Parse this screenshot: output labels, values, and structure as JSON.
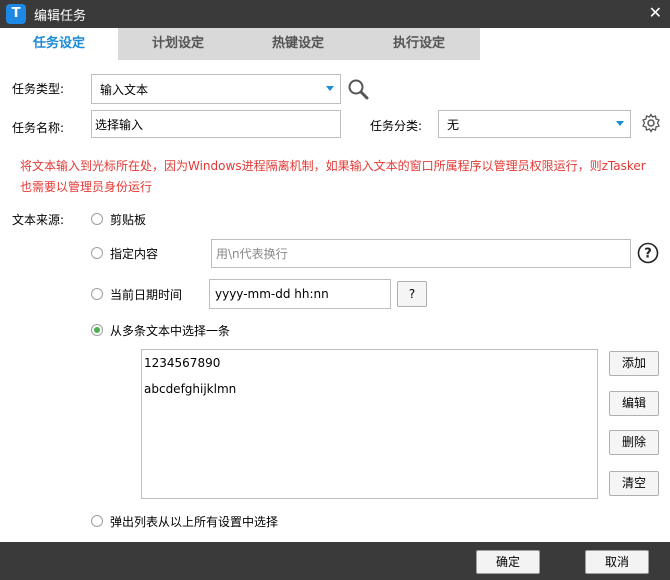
{
  "window": {
    "title": "编辑任务",
    "app_icon_letter": "T"
  },
  "tabs": [
    {
      "label": "任务设定",
      "active": true
    },
    {
      "label": "计划设定",
      "active": false
    },
    {
      "label": "热键设定",
      "active": false
    },
    {
      "label": "执行设定",
      "active": false
    }
  ],
  "form": {
    "task_type_label": "任务类型:",
    "task_type_value": "输入文本",
    "task_name_label": "任务名称:",
    "task_name_value": "选择输入",
    "task_category_label": "任务分类:",
    "task_category_value": "无"
  },
  "warning_line1": "将文本输入到光标所在处，因为Windows进程隔离机制，如果输入文本的窗口所属程序以管理员权限运行，则zTasker",
  "warning_line2": "也需要以管理员身份运行",
  "source": {
    "label": "文本来源:",
    "options": {
      "clipboard": "剪贴板",
      "specified": "指定内容",
      "datetime": "当前日期时间",
      "multi": "从多条文本中选择一条",
      "popup": "弹出列表从以上所有设置中选择"
    },
    "specified_placeholder": "用\\n代表换行",
    "datetime_format": "yyyy-mm-dd hh:nn",
    "datetime_help_label": "?",
    "selected": "multi"
  },
  "text_list": {
    "items": [
      "1234567890",
      "abcdefghijklmn"
    ],
    "add_label": "添加",
    "edit_label": "编辑",
    "delete_label": "删除",
    "clear_label": "清空"
  },
  "footer": {
    "ok_label": "确定",
    "cancel_label": "取消"
  },
  "colors": {
    "accent": "#1a8bd6",
    "warning": "#e53935",
    "titlebar": "#3a3a3a",
    "radio_checked": "#4caf50"
  }
}
